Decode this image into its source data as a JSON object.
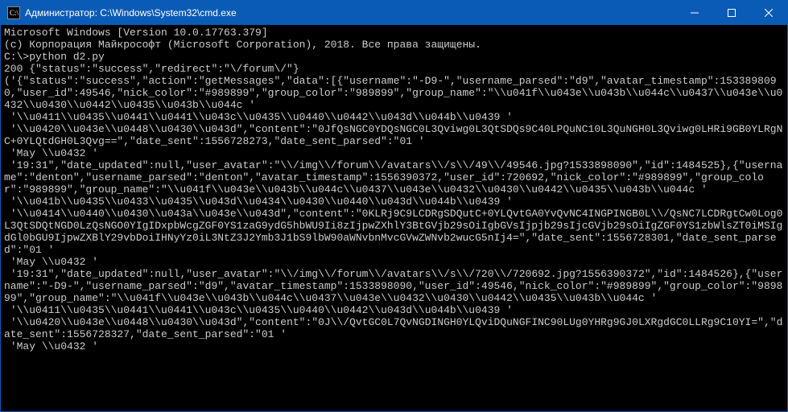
{
  "titlebar": {
    "icon": "cmd-icon",
    "title": "Администратор: C:\\Windows\\System32\\cmd.exe"
  },
  "controls": {
    "minimize": "minimize",
    "maximize": "maximize",
    "close": "close"
  },
  "terminal": {
    "lines": [
      "Microsoft Windows [Version 10.0.17763.379]",
      "(c) Корпорация Майкрософт (Microsoft Corporation), 2018. Все права защищены.",
      "",
      "C:\\>python d2.py",
      "200 {\"status\":\"success\",\"redirect\":\"\\/forum\\/\"}",
      "('{\"status\":\"success\",\"action\":\"getMessages\",\"data\":[{\"username\":\"-D9-\",\"username_parsed\":\"d9\",\"avatar_timestamp\":1533898090,\"user_id\":49546,\"nick_color\":\"#989899\",\"group_color\":\"989899\",\"group_name\":\"\\\\u041f\\\\u043e\\\\u043b\\\\u044c\\\\u0437\\\\u043e\\\\u0432\\\\u0430\\\\u0442\\\\u0435\\\\u043b\\\\u044c '",
      " '\\\\u0411\\\\u0435\\\\u0441\\\\u0441\\\\u043c\\\\u0435\\\\u0440\\\\u0442\\\\u043d\\\\u044b\\\\u0439 '",
      " '\\\\u0420\\\\u043e\\\\u0448\\\\u0430\\\\u043d\",\"content\":\"0JfQsNGC0YDQsNGC0L3Qviwg0L3QtSDQs9C40LPQuNC10L3QuNGH0L3Qviwg0LHRi9GB0YLRgNC+0YLQtdGH0L3Qvg==\",\"date_sent\":1556728273,\"date_sent_parsed\":\"01 '",
      " 'May \\\\u0432 '",
      " '19:31\",\"date_updated\":null,\"user_avatar\":\"\\\\/img\\\\/forum\\\\/avatars\\\\/s\\\\/49\\\\/49546.jpg?1533898090\",\"id\":1484525},{\"username\":\"denton\",\"username_parsed\":\"denton\",\"avatar_timestamp\":1556390372,\"user_id\":720692,\"nick_color\":\"#989899\",\"group_color\":\"989899\",\"group_name\":\"\\\\u041f\\\\u043e\\\\u043b\\\\u044c\\\\u0437\\\\u043e\\\\u0432\\\\u0430\\\\u0442\\\\u0435\\\\u043b\\\\u044c '",
      " '\\\\u041b\\\\u0435\\\\u0433\\\\u0435\\\\u043d\\\\u0434\\\\u0430\\\\u0440\\\\u043d\\\\u044b\\\\u0439 '",
      " '\\\\u0414\\\\u0440\\\\u0430\\\\u043a\\\\u043e\\\\u043d\",\"content\":\"0KLRj9C9LCDRgSDQutC+0YLQvtGA0YvQvNC4INGPINGB0L\\\\/QsNC7LCDRgtCw0Log0L3QtSDQtNGD0LzQsNGO0YIgIDxpbWcgZGF0YS1zaG9ydG5hbWU9Ii8zIjpwZXhlY3BtGVjb29sOiIgbGVsIjpjb29sIjcGVjb29sOiIgZGF0YS1zbWlsZT0iMSIgdGl0bGU9IjpwZXBlY29vbDoiIHNyYz0iL3NtZ3J2Ymb3J1bS9lbW90aWNvbnMvcGVwZWNvb2wucG5nIj4=\",\"date_sent\":1556728301,\"date_sent_parsed\":\"01 '",
      " 'May \\\\u0432 '",
      " '19:31\",\"date_updated\":null,\"user_avatar\":\"\\\\/img\\\\/forum\\\\/avatars\\\\/s\\\\/720\\\\/720692.jpg?1556390372\",\"id\":1484526},{\"username\":\"-D9-\",\"username_parsed\":\"d9\",\"avatar_timestamp\":1533898090,\"user_id\":49546,\"nick_color\":\"#989899\",\"group_color\":\"989899\",\"group_name\":\"\\\\u041f\\\\u043e\\\\u043b\\\\u044c\\\\u0437\\\\u043e\\\\u0432\\\\u0430\\\\u0442\\\\u0435\\\\u043b\\\\u044c '",
      " '\\\\u0411\\\\u0435\\\\u0441\\\\u0441\\\\u043c\\\\u0435\\\\u0440\\\\u0442\\\\u043d\\\\u044b\\\\u0439 '",
      " '\\\\u0420\\\\u043e\\\\u0448\\\\u0430\\\\u043d\",\"content\":\"0J\\\\/QvtGC0L7QvNGDINGH0YLQviDQuNGFINC90LUg0YHRg9GJ0LXRgdGC0LLRg9C10YI=\",\"date_sent\":1556728327,\"date_sent_parsed\":\"01 '",
      " 'May \\\\u0432 '"
    ]
  }
}
